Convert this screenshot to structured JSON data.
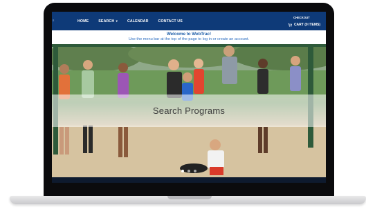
{
  "nav": {
    "items": [
      {
        "label": "HOME"
      },
      {
        "label": "SEARCH"
      },
      {
        "label": "CALENDAR"
      },
      {
        "label": "CONTACT US"
      }
    ],
    "checkout_label": "CHECKOUT",
    "cart_label": "CART (0 ITEMS)"
  },
  "welcome": {
    "title": "Welcome to WebTrac!",
    "subtitle": "Use the menu bar at the top of the page to log in or create an account."
  },
  "hero": {
    "heading": "Search Programs"
  },
  "colors": {
    "nav_bg": "#0e3a78",
    "link": "#1a5aa6"
  }
}
